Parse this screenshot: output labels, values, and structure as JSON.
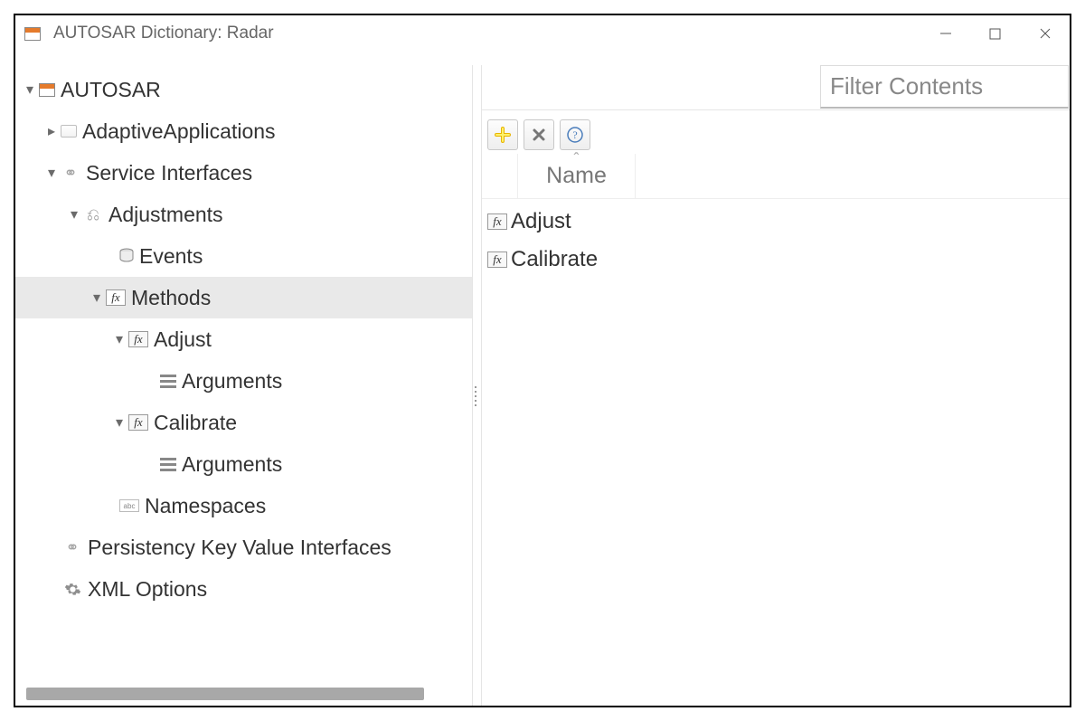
{
  "window": {
    "title": "AUTOSAR Dictionary: Radar"
  },
  "tree": {
    "root": "AUTOSAR",
    "adaptive": "AdaptiveApplications",
    "service_if": "Service Interfaces",
    "adjustments": "Adjustments",
    "events": "Events",
    "methods": "Methods",
    "adjust": "Adjust",
    "adjust_args": "Arguments",
    "calibrate": "Calibrate",
    "calibrate_args": "Arguments",
    "namespaces": "Namespaces",
    "persistency": "Persistency Key Value Interfaces",
    "xml_options": "XML Options"
  },
  "right": {
    "filter_placeholder": "Filter Contents",
    "name_header": "Name",
    "items": {
      "adjust": "Adjust",
      "calibrate": "Calibrate"
    }
  },
  "icons": {
    "abc": "abc"
  }
}
